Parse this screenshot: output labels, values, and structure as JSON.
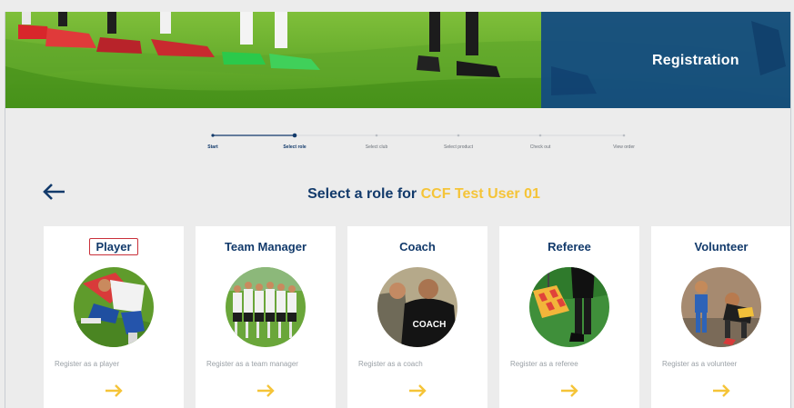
{
  "header": {
    "title": "Registration"
  },
  "stepper": {
    "steps": [
      {
        "label": "Start",
        "status": "done"
      },
      {
        "label": "Select role",
        "status": "current"
      },
      {
        "label": "Select club",
        "status": "pending"
      },
      {
        "label": "Select product",
        "status": "pending"
      },
      {
        "label": "Check out",
        "status": "pending"
      },
      {
        "label": "View order",
        "status": "pending"
      }
    ]
  },
  "heading": {
    "prefix": "Select a role for ",
    "user": "CCF Test User 01"
  },
  "roles": [
    {
      "title": "Player",
      "description": "Register as a player",
      "icon": "player-photo"
    },
    {
      "title": "Team Manager",
      "description": "Register as a team manager",
      "icon": "team-manager-photo"
    },
    {
      "title": "Coach",
      "description": "Register as a coach",
      "icon": "coach-photo",
      "image_text": "COACH"
    },
    {
      "title": "Referee",
      "description": "Register as a referee",
      "icon": "referee-photo"
    },
    {
      "title": "Volunteer",
      "description": "Register as a volunteer",
      "icon": "volunteer-photo"
    }
  ],
  "colors": {
    "navy": "#123a6b",
    "accent": "#f5c438",
    "banner_overlay": "#124a82",
    "background": "#ececec"
  }
}
